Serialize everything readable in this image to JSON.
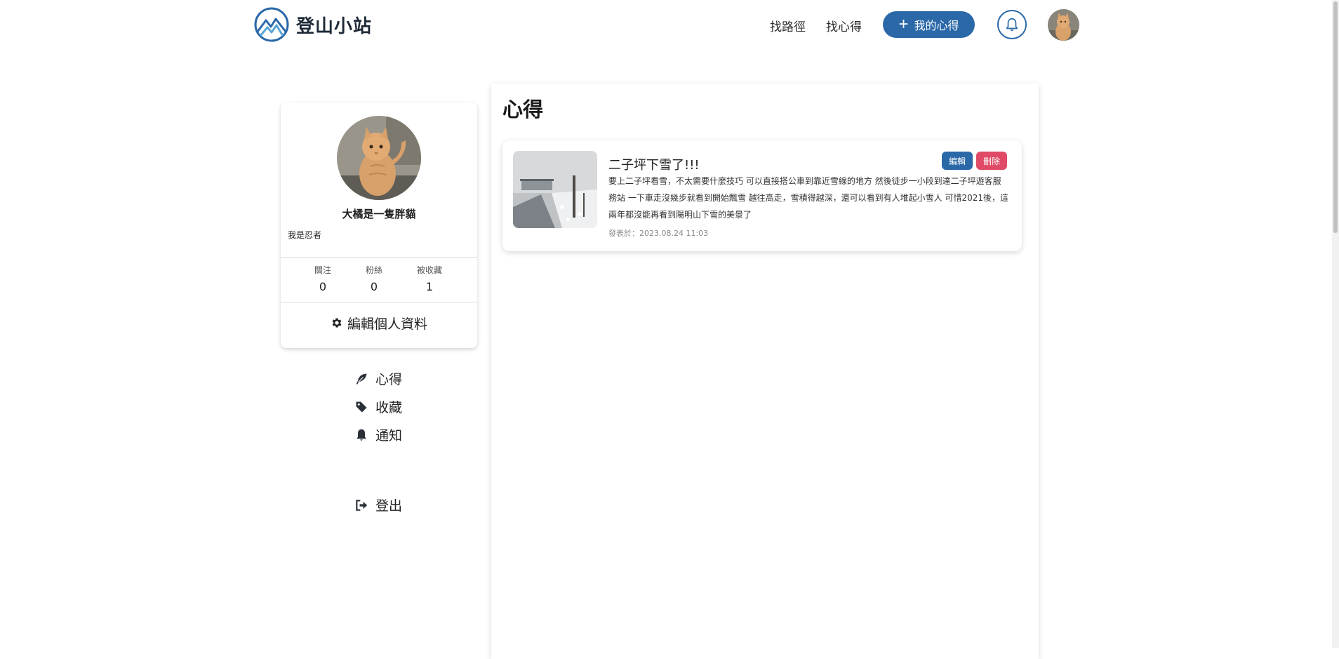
{
  "header": {
    "site_name": "登山小站",
    "nav_find_trail": "找路徑",
    "nav_find_experience": "找心得",
    "my_experience_button": "我的心得",
    "brand_color": "#2a68a8"
  },
  "profile": {
    "name": "大橘是一隻胖貓",
    "bio": "我是忍者",
    "stats": [
      {
        "label": "關注",
        "value": "0"
      },
      {
        "label": "粉絲",
        "value": "0"
      },
      {
        "label": "被收藏",
        "value": "1"
      }
    ],
    "edit_button": "編輯個人資料"
  },
  "side_menu": {
    "experience": "心得",
    "bookmarks": "收藏",
    "notifications": "通知",
    "logout": "登出"
  },
  "main": {
    "title": "心得",
    "posts": [
      {
        "title": "二子坪下雪了!!!",
        "body": "要上二子坪看雪，不太需要什麼技巧 可以直接搭公車到靠近雪線的地方 然後徒步一小段到達二子坪遊客服務站 一下車走沒幾步就看到開始飄雪 越往高走，雪積得越深，還可以看到有人堆起小雪人 可惜2021後，這兩年都沒能再看到陽明山下雪的美景了",
        "date": "發表於：2023.08.24 11:03",
        "edit_label": "編輯",
        "delete_label": "刪除"
      }
    ]
  },
  "icons": {
    "logo": "mountain-logo-icon",
    "plus": "plus-icon",
    "bell": "bell-icon",
    "gear": "gear-icon",
    "feather": "feather-icon",
    "tag": "tag-icon",
    "bell_menu": "bell-icon",
    "logout": "logout-icon"
  },
  "colors": {
    "primary": "#2a68a8",
    "danger": "#e04a66"
  }
}
